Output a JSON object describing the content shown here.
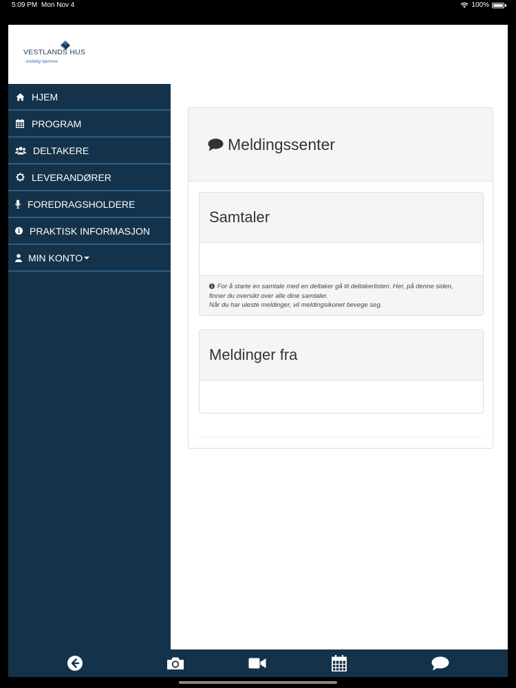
{
  "status": {
    "time": "5:09 PM",
    "date": "Mon Nov 4",
    "battery_text": "100%"
  },
  "logo": {
    "name": "VESTLANDS HUS",
    "tagline": "- endelig hjemme",
    "brand_color": "#1f3a5a",
    "accent_color": "#3a6ea5"
  },
  "sidebar": {
    "background": "#14334a",
    "items": [
      {
        "label": "HJEM",
        "icon": "home-icon"
      },
      {
        "label": "PROGRAM",
        "icon": "calendar-icon"
      },
      {
        "label": "DELTAKERE",
        "icon": "users-icon"
      },
      {
        "label": "LEVERANDØRER",
        "icon": "gear-icon"
      },
      {
        "label": "FOREDRAGSHOLDERE",
        "icon": "microphone-icon"
      },
      {
        "label": "PRAKTISK INFORMASJON",
        "icon": "info-icon"
      },
      {
        "label": "MIN KONTO",
        "icon": "user-icon",
        "has_dropdown": true
      }
    ]
  },
  "main": {
    "title": "Meldingssenter",
    "title_icon": "chat-icon",
    "conversations": {
      "title": "Samtaler",
      "info_lines": [
        "For å starte en samtale med en deltaker gå til deltakerlisten. Her, på denne siden,",
        "finner du oversikt over alle dine samtaler.",
        "Når du har uleste meldinger, vil meldingsikonet bevege seg."
      ]
    },
    "messages_from": {
      "title": "Meldinger fra"
    }
  },
  "bottombar": {
    "buttons": [
      "back-arrow-icon",
      "camera-icon",
      "video-camera-icon",
      "calendar-icon",
      "chat-icon"
    ]
  }
}
